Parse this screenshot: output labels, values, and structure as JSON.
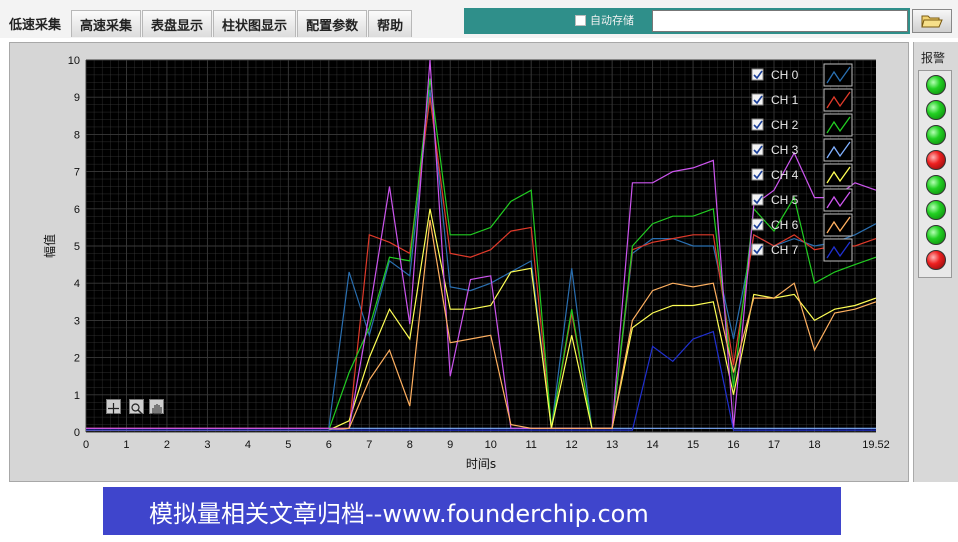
{
  "tabs": [
    {
      "label": "低速采集",
      "active": true
    },
    {
      "label": "高速采集",
      "active": false
    },
    {
      "label": "表盘显示",
      "active": false
    },
    {
      "label": "柱状图显示",
      "active": false
    },
    {
      "label": "配置参数",
      "active": false
    },
    {
      "label": "帮助",
      "active": false
    }
  ],
  "autosave": {
    "label": "自动存储",
    "checked": false
  },
  "path_value": "",
  "folder_icon": "folder-open-icon",
  "alarm": {
    "title": "报警",
    "states": [
      "green",
      "green",
      "green",
      "red",
      "green",
      "green",
      "green",
      "red"
    ]
  },
  "chart_tools": [
    "crosshair-icon",
    "zoom-icon",
    "hand-pan-icon"
  ],
  "banner": "模拟量相关文章归档--www.founderchip.com",
  "chart_data": {
    "type": "line",
    "xlabel": "时间s",
    "ylabel": "幅值",
    "xlim": [
      0,
      19.52
    ],
    "ylim": [
      0,
      10
    ],
    "x_ticks": [
      "0",
      "1",
      "2",
      "3",
      "4",
      "5",
      "6",
      "7",
      "8",
      "9",
      "10",
      "11",
      "12",
      "13",
      "14",
      "15",
      "16",
      "17",
      "18",
      "19.52"
    ],
    "y_ticks": [
      "0",
      "1",
      "2",
      "3",
      "4",
      "5",
      "6",
      "7",
      "8",
      "9",
      "10"
    ],
    "grid": true,
    "background": "#000000",
    "gridcolor": "#3a3a3a",
    "legend_position": "top-right",
    "x": [
      0,
      0.5,
      1,
      1.5,
      2,
      2.5,
      3,
      3.5,
      4,
      4.5,
      5,
      5.5,
      6,
      6.5,
      7,
      7.5,
      8,
      8.5,
      9,
      9.5,
      10,
      10.5,
      11,
      11.5,
      12,
      12.5,
      13,
      13.5,
      14,
      14.5,
      15,
      15.5,
      16,
      16.5,
      17,
      17.5,
      18,
      18.5,
      19,
      19.52
    ],
    "series": [
      {
        "name": "CH 0",
        "color": "#2a6fb0",
        "checked": true,
        "values": [
          0.1,
          0.1,
          0.1,
          0.1,
          0.1,
          0.1,
          0.1,
          0.1,
          0.1,
          0.1,
          0.1,
          0.1,
          0.1,
          4.3,
          2.6,
          4.6,
          4.2,
          9.2,
          3.9,
          3.8,
          4.0,
          4.3,
          4.6,
          0.1,
          4.4,
          0.1,
          0.1,
          4.8,
          5.2,
          5.2,
          5.0,
          5.0,
          2.5,
          5.3,
          5.0,
          5.2,
          5.0,
          5.1,
          5.3,
          5.6
        ]
      },
      {
        "name": "CH 1",
        "color": "#e03a2a",
        "checked": true,
        "values": [
          0.1,
          0.1,
          0.1,
          0.1,
          0.1,
          0.1,
          0.1,
          0.1,
          0.1,
          0.1,
          0.1,
          0.1,
          0.1,
          0.1,
          5.3,
          5.1,
          4.8,
          9.0,
          4.8,
          4.7,
          4.9,
          5.4,
          5.5,
          0.1,
          3.2,
          0.1,
          0.1,
          4.9,
          5.1,
          5.2,
          5.3,
          5.3,
          1.8,
          5.3,
          5.0,
          5.3,
          4.9,
          5.0,
          5.0,
          5.2
        ]
      },
      {
        "name": "CH 2",
        "color": "#22cc22",
        "checked": true,
        "values": [
          0.05,
          0.05,
          0.05,
          0.05,
          0.05,
          0.05,
          0.05,
          0.05,
          0.05,
          0.05,
          0.05,
          0.05,
          0.05,
          1.6,
          2.8,
          4.7,
          4.6,
          9.5,
          5.3,
          5.3,
          5.5,
          6.2,
          6.5,
          0.1,
          3.3,
          0.1,
          0.1,
          5.0,
          5.6,
          5.8,
          5.8,
          6.0,
          1.2,
          6.0,
          5.4,
          6.3,
          4.0,
          4.3,
          4.5,
          4.7
        ]
      },
      {
        "name": "CH 3",
        "color": "#80b0ff",
        "checked": true,
        "values": [
          0.05,
          0.05,
          0.05,
          0.05,
          0.05,
          0.05,
          0.05,
          0.05,
          0.05,
          0.05,
          0.05,
          0.05,
          0.05,
          0.1,
          0.1,
          0.1,
          0.1,
          0.1,
          0.1,
          0.1,
          0.1,
          0.1,
          0.1,
          0.1,
          0.1,
          0.1,
          0.1,
          0.1,
          0.1,
          0.1,
          0.1,
          0.1,
          0.1,
          0.1,
          0.1,
          0.1,
          0.1,
          0.1,
          0.1,
          0.1
        ]
      },
      {
        "name": "CH 4",
        "color": "#ffff55",
        "checked": true,
        "values": [
          0.05,
          0.05,
          0.05,
          0.05,
          0.05,
          0.05,
          0.05,
          0.05,
          0.05,
          0.05,
          0.05,
          0.05,
          0.05,
          0.3,
          2.0,
          3.3,
          2.5,
          6.0,
          3.3,
          3.3,
          3.4,
          4.3,
          4.4,
          0.1,
          2.6,
          0.1,
          0.1,
          2.8,
          3.2,
          3.4,
          3.4,
          3.5,
          1.0,
          3.7,
          3.6,
          3.7,
          3.0,
          3.3,
          3.4,
          3.6
        ]
      },
      {
        "name": "CH 5",
        "color": "#cc55ee",
        "checked": true,
        "values": [
          0.1,
          0.1,
          0.1,
          0.1,
          0.1,
          0.1,
          0.1,
          0.1,
          0.1,
          0.1,
          0.1,
          0.1,
          0.1,
          0.1,
          3.2,
          6.6,
          2.9,
          10.0,
          1.5,
          4.1,
          4.2,
          0.1,
          0.1,
          0.1,
          0.1,
          0.1,
          0.1,
          6.7,
          6.7,
          7.0,
          7.1,
          7.3,
          0.1,
          6.1,
          6.5,
          7.5,
          6.3,
          6.3,
          6.7,
          6.5
        ]
      },
      {
        "name": "CH 6",
        "color": "#ffb060",
        "checked": true,
        "values": [
          0.05,
          0.05,
          0.05,
          0.05,
          0.05,
          0.05,
          0.05,
          0.05,
          0.05,
          0.05,
          0.05,
          0.05,
          0.05,
          0.1,
          1.4,
          2.2,
          0.7,
          5.7,
          2.4,
          2.5,
          2.6,
          0.2,
          0.1,
          0.1,
          0.1,
          0.1,
          0.1,
          3.0,
          3.8,
          4.0,
          3.9,
          4.0,
          1.6,
          3.6,
          3.6,
          4.0,
          2.2,
          3.2,
          3.3,
          3.5
        ]
      },
      {
        "name": "CH 7",
        "color": "#2030d0",
        "checked": true,
        "values": [
          0.05,
          0.05,
          0.05,
          0.05,
          0.05,
          0.05,
          0.05,
          0.05,
          0.05,
          0.05,
          0.05,
          0.05,
          0.05,
          0.05,
          0.05,
          0.05,
          0.05,
          0.05,
          0.05,
          0.05,
          0.05,
          0.05,
          0.05,
          0.05,
          0.05,
          0.05,
          0.05,
          0.05,
          2.3,
          1.9,
          2.5,
          2.7,
          0.05,
          0.05,
          0.05,
          0.05,
          0.05,
          0.05,
          0.05,
          0.05
        ]
      }
    ]
  }
}
